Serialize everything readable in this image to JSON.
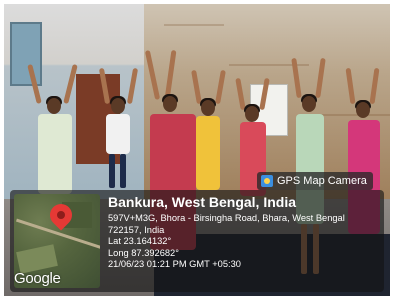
{
  "badge": {
    "label": "GPS Map Camera",
    "icon": "camera-icon"
  },
  "map": {
    "watermark": "Google",
    "pin_icon": "map-pin-icon"
  },
  "location": {
    "title": "Bankura, West Bengal, India",
    "address_line1": "597V+M3G, Bhora - Birsingha Road, Bhara, West Bengal",
    "address_line2": "722157, India",
    "lat": "Lat 23.164132°",
    "long": "Long 87.392682°",
    "datetime": "21/06/23 01:21 PM GMT +05:30"
  },
  "colors": {
    "pin": "#e53935",
    "panel": "#141414"
  }
}
